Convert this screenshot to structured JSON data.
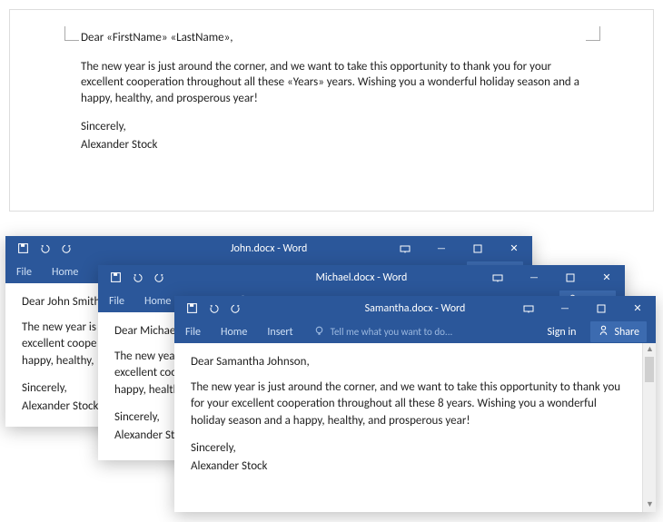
{
  "template": {
    "greeting": "Dear «FirstName» «LastName»,",
    "body": "The new year is just around the corner, and we want to take this opportunity to thank you for your excellent cooperation throughout all these «Years» years. Wishing you a wonderful holiday season and a happy, healthy, and prosperous year!",
    "signoff": "Sincerely,",
    "signature": "Alexander Stock"
  },
  "windows": [
    {
      "title": "John.docx - Word",
      "greeting": "Dear John Smith",
      "body_fragment1": "The new year is j",
      "body_fragment2": "excellent coope",
      "body_fragment3": "happy, healthy,",
      "signoff": "Sincerely,",
      "signature": "Alexander Stock"
    },
    {
      "title": "Michael.docx - Word",
      "greeting": "Dear Michael Ro",
      "body_fragment1": "The new year is",
      "body_fragment2": "excellent cooper",
      "body_fragment3": "happy, healthy, a",
      "signoff": "Sincerely,",
      "signature": "Alexander Stock"
    },
    {
      "title": "Samantha.docx - Word",
      "greeting": "Dear Samantha Johnson,",
      "body": "The new year is just around the corner, and we want to take this opportunity to thank you for your excellent cooperation throughout all these 8 years. Wishing you a wonderful holiday season and a happy, healthy, and prosperous year!",
      "signoff": "Sincerely,",
      "signature": "Alexander Stock"
    }
  ],
  "ribbon": {
    "file": "File",
    "home": "Home",
    "insert": "Insert",
    "tellme": "Tell me what you want to do...",
    "signin": "Sign in",
    "share": "Share"
  }
}
